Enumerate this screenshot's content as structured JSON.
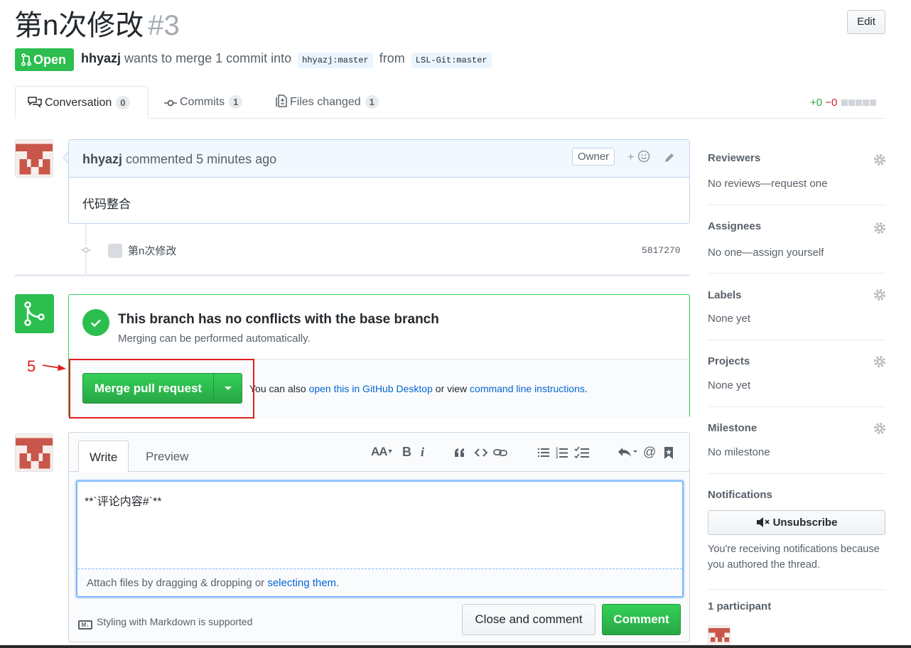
{
  "pr": {
    "title": "第n次修改",
    "number": "#3",
    "edit_label": "Edit",
    "state": "Open",
    "author": "hhyazj",
    "merge_text": "wants to merge 1 commit into",
    "base_branch": "hhyazj:master",
    "from_text": "from",
    "head_branch": "LSL-Git:master"
  },
  "tabs": [
    {
      "label": "Conversation",
      "count": "0"
    },
    {
      "label": "Commits",
      "count": "1"
    },
    {
      "label": "Files changed",
      "count": "1"
    }
  ],
  "diffstat": {
    "additions": "+0",
    "deletions": "−0"
  },
  "comment": {
    "author": "hhyazj",
    "action": "commented 5 minutes ago",
    "badge": "Owner",
    "reaction": "+",
    "body": "代码整合"
  },
  "commit": {
    "message": "第n次修改",
    "sha": "5817270"
  },
  "merge": {
    "title": "This branch has no conflicts with the base branch",
    "subtitle": "Merging can be performed automatically.",
    "button_label": "Merge pull request",
    "note_prefix": "You can also",
    "desktop_link": "open this in GitHub Desktop",
    "note_middle": "or view",
    "cli_link": "command line instructions",
    "note_suffix": "."
  },
  "annotation": {
    "number": "5",
    "color": "#e02020"
  },
  "composer": {
    "tab_write": "Write",
    "tab_preview": "Preview",
    "toolbar": {
      "heading": "AA",
      "bold": "B",
      "italic": "i",
      "mention": "@"
    },
    "text": "**`评论内容#`**",
    "attach_prefix": "Attach files by dragging & dropping or",
    "attach_link": "selecting them",
    "attach_suffix": ".",
    "markdown_badge": "M↓",
    "markdown_note": "Styling with Markdown is supported",
    "close_label": "Close and comment",
    "comment_label": "Comment"
  },
  "sidebar": {
    "reviewers": {
      "title": "Reviewers",
      "value": "No reviews—request one"
    },
    "assignees": {
      "title": "Assignees",
      "value": "No one—assign yourself"
    },
    "labels": {
      "title": "Labels",
      "value": "None yet"
    },
    "projects": {
      "title": "Projects",
      "value": "None yet"
    },
    "milestone": {
      "title": "Milestone",
      "value": "No milestone"
    },
    "notifications": {
      "title": "Notifications",
      "button": "Unsubscribe",
      "text": "You're receiving notifications because you authored the thread."
    },
    "participants": "1 participant"
  },
  "colors": {
    "open_green": "#2cbe4e",
    "link_blue": "#0366d6",
    "annotation_red": "#e02020",
    "avatar_red": "#c9564a"
  }
}
